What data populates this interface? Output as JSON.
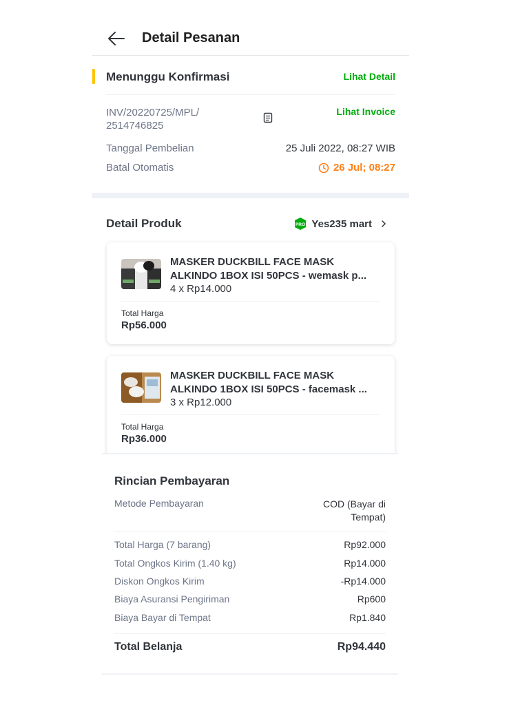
{
  "header": {
    "title": "Detail Pesanan"
  },
  "status": {
    "label": "Menunggu Konfirmasi",
    "detail_link": "Lihat Detail",
    "invoice_number_line1": "INV/20220725/MPL/",
    "invoice_number_line2": "2514746825",
    "invoice_link": "Lihat Invoice",
    "purchase_date_label": "Tanggal Pembelian",
    "purchase_date_value": "25 Juli 2022, 08:27 WIB",
    "auto_cancel_label": "Batal Otomatis",
    "auto_cancel_value": "26 Jul; 08:27"
  },
  "products": {
    "section_title": "Detail Produk",
    "shop_badge": "PRO",
    "shop_name": "Yes235 mart",
    "items": [
      {
        "name_line1": "MASKER DUCKBILL FACE MASK",
        "name_line2": "ALKINDO 1BOX ISI 50PCS - wemask p...",
        "qty_price": "4 x Rp14.000",
        "total_label": "Total Harga",
        "total_value": "Rp56.000"
      },
      {
        "name_line1": "MASKER DUCKBILL FACE MASK",
        "name_line2": "ALKINDO 1BOX ISI 50PCS - facemask ...",
        "qty_price": "3 x Rp12.000",
        "total_label": "Total Harga",
        "total_value": "Rp36.000"
      }
    ]
  },
  "payment": {
    "title": "Rincian Pembayaran",
    "method_label": "Metode Pembayaran",
    "method_value_line1": "COD (Bayar di",
    "method_value_line2": "Tempat)",
    "rows": [
      {
        "label": "Total Harga (7 barang)",
        "value": "Rp92.000"
      },
      {
        "label": "Total Ongkos Kirim (1.40 kg)",
        "value": "Rp14.000"
      },
      {
        "label": "Diskon Ongkos Kirim",
        "value": "-Rp14.000"
      },
      {
        "label": "Biaya Asuransi Pengiriman",
        "value": "Rp600"
      },
      {
        "label": "Biaya Bayar di Tempat",
        "value": "Rp1.840"
      }
    ],
    "total_label": "Total Belanja",
    "total_value": "Rp94.440"
  },
  "colors": {
    "green": "#03ac0e",
    "orange": "#ff7f17",
    "yellow": "#ffc400"
  },
  "icons": [
    "back-arrow-icon",
    "copy-icon",
    "clock-icon",
    "pro-badge-icon",
    "chevron-right-icon"
  ]
}
